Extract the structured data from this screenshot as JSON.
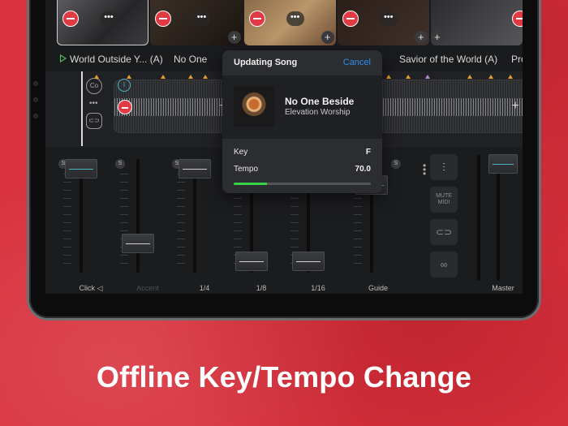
{
  "song_titles": {
    "current": "World Outside Y... (A)",
    "next": "No One",
    "later": "Savior of the World (A)",
    "last": "Pro"
  },
  "modal": {
    "title": "Updating Song",
    "cancel_label": "Cancel",
    "song_name": "No One Beside",
    "artist": "Elevation Worship",
    "key_label": "Key",
    "key_value": "F",
    "tempo_label": "Tempo",
    "tempo_value": "70.0",
    "progress": 0.24
  },
  "mixer": {
    "channels": [
      {
        "label": "Click ◁",
        "dim": false
      },
      {
        "label": "Accent",
        "dim": true
      },
      {
        "label": "1/4",
        "dim": false
      },
      {
        "label": "1/8",
        "dim": false
      },
      {
        "label": "1/16",
        "dim": false
      },
      {
        "label": "Guide",
        "dim": false
      }
    ],
    "solo_label": "S",
    "mute_midi_label": "MUTE\nMIDI",
    "master_label": "Master"
  },
  "wave_markers": {
    "blue_label": "I"
  },
  "caption": "Offline Key/Tempo Change",
  "colors": {
    "background": "#d8323d",
    "accent_green": "#38d24a",
    "link_blue": "#2f8ff0",
    "delete_red": "#e03a45"
  }
}
